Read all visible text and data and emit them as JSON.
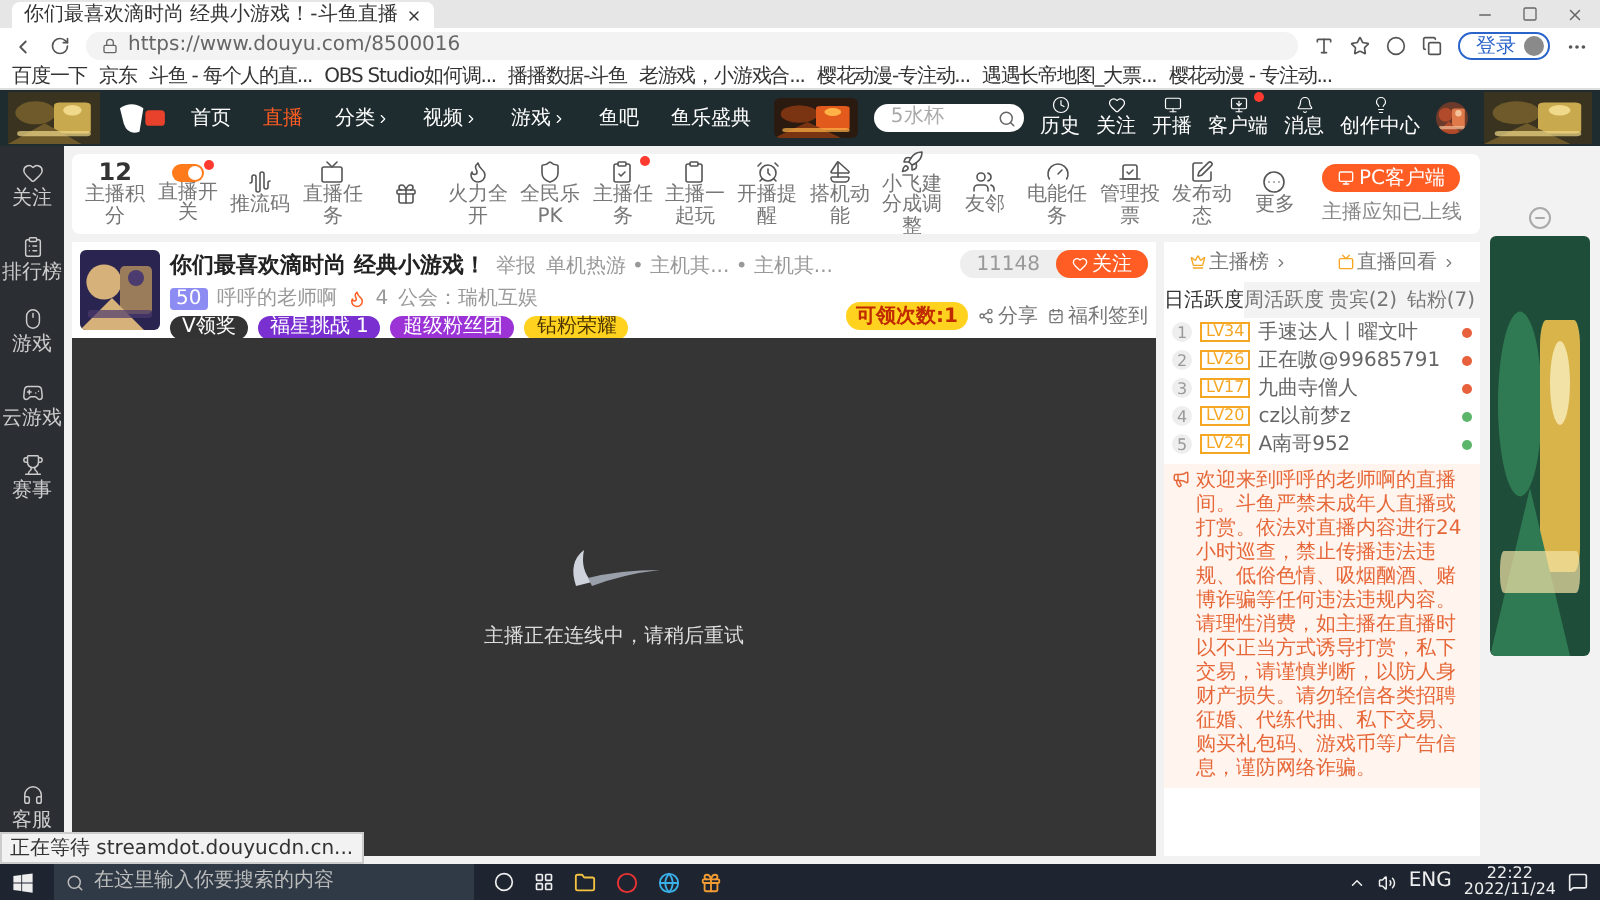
{
  "browser": {
    "tab_title": "你们最喜欢滴时尚 经典小游戏！-斗鱼直播",
    "url": "https://www.douyu.com/8500016",
    "login_button": "登录",
    "bookmarks": [
      "百度一下",
      "京东",
      "斗鱼 - 每个人的直...",
      "OBS Studio如何调...",
      "播播数据-斗鱼",
      "老游戏，小游戏合...",
      "樱花动漫-专注动...",
      "遇遇长帝地图_大票...",
      "樱花动漫 - 专注动..."
    ]
  },
  "site_header": {
    "nav": [
      {
        "label": "首页",
        "selected": false,
        "menu": false
      },
      {
        "label": "直播",
        "selected": true,
        "menu": false
      },
      {
        "label": "分类",
        "selected": false,
        "menu": true
      },
      {
        "label": "视频",
        "selected": false,
        "menu": true
      },
      {
        "label": "游戏",
        "selected": false,
        "menu": true
      },
      {
        "label": "鱼吧",
        "selected": false,
        "menu": false
      },
      {
        "label": "鱼乐盛典",
        "selected": false,
        "menu": false
      }
    ],
    "search": {
      "placeholder": "5水杯"
    },
    "actions": [
      {
        "label": "历史",
        "kind": "history",
        "badge": false
      },
      {
        "label": "关注",
        "kind": "follow",
        "badge": false
      },
      {
        "label": "开播",
        "kind": "live",
        "badge": false
      },
      {
        "label": "客户端",
        "kind": "client",
        "badge": true
      },
      {
        "label": "消息",
        "kind": "message",
        "badge": false
      },
      {
        "label": "创作中心",
        "kind": "creator",
        "badge": false
      }
    ]
  },
  "sidebar": {
    "items": [
      {
        "label": "关注",
        "kind": "follow"
      },
      {
        "label": "排行榜",
        "kind": "ranking"
      },
      {
        "label": "游戏",
        "kind": "games"
      },
      {
        "label": "云游戏",
        "kind": "cloud"
      },
      {
        "label": "赛事",
        "kind": "events"
      }
    ],
    "bottom": {
      "label": "客服",
      "kind": "service"
    }
  },
  "toolbar": {
    "score": {
      "value": "12",
      "label": "主播积分"
    },
    "tools": [
      {
        "label": "直播开关",
        "kind": "switch",
        "on": true,
        "badge": true
      },
      {
        "label": "推流码",
        "kind": "wave",
        "badge": false
      },
      {
        "label": "直播任务",
        "kind": "tv",
        "badge": false
      },
      {
        "kind": "gift",
        "badge": false
      },
      {
        "label": "火力全开",
        "kind": "fire",
        "badge": false
      },
      {
        "label": "全民乐PK",
        "kind": "shield",
        "badge": false
      },
      {
        "label": "主播任务",
        "kind": "task",
        "badge": true
      },
      {
        "label": "主播一起玩",
        "kind": "clipboard",
        "badge": false
      },
      {
        "label": "开播提醒",
        "kind": "alarm",
        "badge": false
      },
      {
        "label": "搭机动能",
        "kind": "boat",
        "badge": false
      },
      {
        "label": "小飞建分成调整",
        "kind": "rocket",
        "badge": false
      },
      {
        "label": "友邻",
        "kind": "users",
        "badge": false
      },
      {
        "label": "电能任务",
        "kind": "gauge",
        "badge": false
      },
      {
        "label": "管理投票",
        "kind": "vote",
        "badge": false
      },
      {
        "label": "发布动态",
        "kind": "pen",
        "badge": false
      },
      {
        "label": "更多",
        "kind": "more",
        "badge": false
      }
    ],
    "pc_client": {
      "button": "PC客户端",
      "note": "主播应知已上线"
    }
  },
  "stream": {
    "title": "你们最喜欢滴时尚 经典小游戏！",
    "report": "举报",
    "category": "单机热游 • 主机其... • 主机其...",
    "level": "50",
    "streamer": "呼呼的老师啊",
    "hot": "4",
    "guild": "公会：瑞机互娱",
    "tags": [
      {
        "label": "V领奖",
        "color": "#333333"
      },
      {
        "label": "福星挑战 1",
        "color": "#7a2fd0"
      },
      {
        "label": "超级粉丝团",
        "color": "#9b33d6"
      },
      {
        "label": "钻粉荣耀",
        "color": "#ffd21f"
      }
    ],
    "followers": "11148",
    "follow_button": "关注",
    "claim": "可领次数:1",
    "share": "分享",
    "welfare": "福利签到",
    "status": "主播正在连线中，请稍后重试"
  },
  "side_panel": {
    "links": [
      "主播榜",
      "直播回看"
    ],
    "tabs": [
      {
        "label": "日活跃度",
        "selected": true
      },
      {
        "label": "周活跃度",
        "selected": false
      },
      {
        "label": "贵宾(2)",
        "selected": false
      },
      {
        "label": "钻粉(7)",
        "selected": false
      }
    ],
    "ranking": [
      {
        "rank": "1",
        "level": "LV34",
        "name": "手速达人丨曜文叶",
        "color": "#e8603c"
      },
      {
        "rank": "2",
        "level": "LV26",
        "name": "正在嗷@99685791",
        "color": "#e8603c"
      },
      {
        "rank": "3",
        "level": "LV17",
        "name": "九曲寺僧人",
        "color": "#e8603c"
      },
      {
        "rank": "4",
        "level": "LV20",
        "name": "cz以前梦z",
        "color": "#5bb56a"
      },
      {
        "rank": "5",
        "level": "LV24",
        "name": "A南哥952",
        "color": "#5bb56a"
      }
    ],
    "notice": "欢迎来到呼呼的老师啊的直播间。斗鱼严禁未成年人直播或打赏。依法对直播内容进行24小时巡查，禁止传播违法违规、低俗色情、吸烟酗酒、赌博诈骗等任何违法违规内容。请理性消费，如主播在直播时以不正当方式诱导打赏，私下交易，请谨慎判断，以防人身财产损失。请勿轻信各类招聘征婚、代练代抽、私下交易、购买礼包码、游戏币等广告信息，谨防网络诈骗。"
  },
  "status_tooltip": "正在等待 streamdot.douyucdn.cn...",
  "taskbar": {
    "search_placeholder": "在这里输入你要搜索的内容",
    "language": "ENG",
    "time": "22:22",
    "date": "2022/11/24"
  }
}
